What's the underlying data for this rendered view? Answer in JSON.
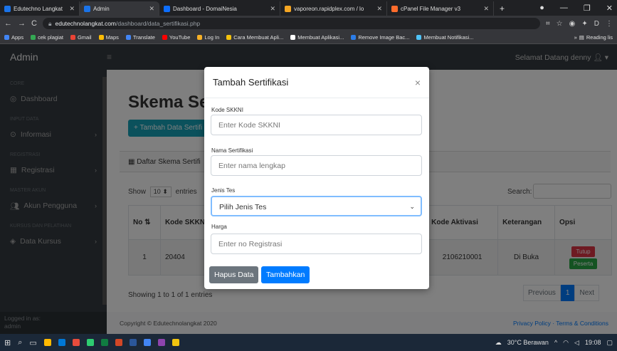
{
  "browser": {
    "tabs": [
      {
        "label": "Edutechno Langkat",
        "color": "#1a73e8"
      },
      {
        "label": "Admin",
        "color": "#1a73e8"
      },
      {
        "label": "Dashboard - DomaiNesia",
        "color": "#0d6efd"
      },
      {
        "label": "vaporeon.rapidplex.com / lo",
        "color": "#f5a623"
      },
      {
        "label": "cPanel File Manager v3",
        "color": "#ff6c2c"
      }
    ],
    "url_host": "edutechnolangkat.com",
    "url_path": "/dashboard/data_sertifikasi.php",
    "bookmarks": [
      {
        "label": "Apps",
        "color": "#4285f4"
      },
      {
        "label": "cek plagiat",
        "color": "#34a853"
      },
      {
        "label": "Gmail",
        "color": "#ea4335"
      },
      {
        "label": "Maps",
        "color": "#fbbc05"
      },
      {
        "label": "Translate",
        "color": "#4285f4"
      },
      {
        "label": "YouTube",
        "color": "#ff0000"
      },
      {
        "label": "Log In",
        "color": "#f6b026"
      },
      {
        "label": "Cara Membuat Apli...",
        "color": "#f4c20d"
      },
      {
        "label": "Membuat Aplikasi...",
        "color": "#ffffff"
      },
      {
        "label": "Remove Image Bac...",
        "color": "#2b7de9"
      },
      {
        "label": "Membuat Notifikasi...",
        "color": "#4fc3f7"
      }
    ],
    "reading_list": "Reading lis"
  },
  "topnav": {
    "brand": "Admin",
    "welcome": "Selamat Datang denny"
  },
  "sidebar": {
    "sec_core": "CORE",
    "dashboard": "Dashboard",
    "sec_input": "INPUT DATA",
    "informasi": "Informasi",
    "sec_reg": "REGISTRASI",
    "registrasi": "Registrasi",
    "sec_master": "MASTER AKUN",
    "akun": "Akun Pengguna",
    "sec_kursus": "KURSUS DAN PELATIHAN",
    "data_kursus": "Data Kursus",
    "logged_in_label": "Logged in as:",
    "logged_in_user": "admin"
  },
  "main": {
    "title": "Skema Ser",
    "add_button": "Tambah Data Sertifi",
    "card_header": "Daftar Skema Sertifi",
    "show_label": "Show",
    "entries_value": "10",
    "entries_label": "entries",
    "search_label": "Search:",
    "table": {
      "headers": {
        "no": "No",
        "kode": "Kode SKKNI",
        "aktivasi": "Kode Aktivasi",
        "keterangan": "Keterangan",
        "opsi": "Opsi"
      },
      "row": {
        "no": "1",
        "kode": "20404",
        "aktivasi": "2106210001",
        "keterangan": "Di Buka",
        "tutup": "Tutup",
        "peserta": "Peserta"
      }
    },
    "showing": "Showing 1 to 1 of 1 entries",
    "prev": "Previous",
    "page": "1",
    "next": "Next"
  },
  "footer": {
    "copyright": "Copyright © Edutechnolangkat 2020",
    "links": "Privacy Policy · Terms & Conditions"
  },
  "modal": {
    "title": "Tambah Sertifikasi",
    "close": "×",
    "kode_label": "Kode SKKNI",
    "kode_placeholder": "Enter Kode SKKNI",
    "nama_label": "Nama Sertifikasi",
    "nama_placeholder": "Enter nama lengkap",
    "jenis_label": "Jenis Tes",
    "jenis_value": "Pilih Jenis Tes",
    "harga_label": "Harga",
    "harga_placeholder": "Enter no Registrasi",
    "hapus": "Hapus Data",
    "tambah": "Tambahkan"
  },
  "taskbar": {
    "weather": "30°C Berawan",
    "time": "19:08"
  }
}
